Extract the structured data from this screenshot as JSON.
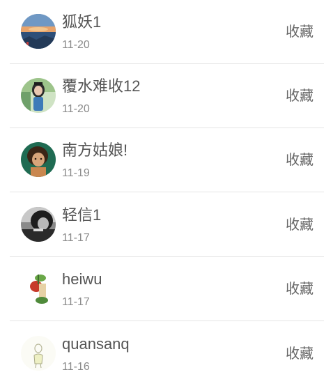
{
  "items": [
    {
      "name": "狐妖1",
      "date": "11-20",
      "action": "收藏",
      "avatar": "sunset-landscape-avatar"
    },
    {
      "name": "覆水难收12",
      "date": "11-20",
      "action": "收藏",
      "avatar": "girl-portrait-avatar"
    },
    {
      "name": "南方姑娘!",
      "date": "11-19",
      "action": "收藏",
      "avatar": "illustrated-woman-avatar"
    },
    {
      "name": "轻信1",
      "date": "11-17",
      "action": "收藏",
      "avatar": "dark-portrait-avatar"
    },
    {
      "name": "heiwu",
      "date": "11-17",
      "action": "收藏",
      "avatar": "cartoon-plant-avatar"
    },
    {
      "name": "quansanq",
      "date": "11-16",
      "action": "收藏",
      "avatar": "sketch-figure-avatar"
    }
  ]
}
